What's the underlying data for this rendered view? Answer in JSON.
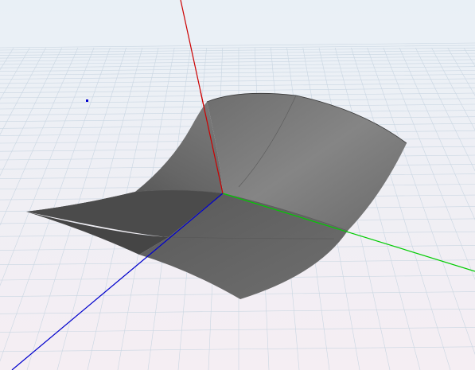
{
  "viewport": {
    "background_top": "#e9f0f6",
    "background_bottom": "#f5eef3",
    "grid_color": "#c9d6e2"
  },
  "axes": {
    "x_axis_color": "#0000cc",
    "y_axis_color": "#00cc00",
    "z_axis_color": "#cc0000"
  },
  "surface": {
    "fill_color": "#7a7a7a",
    "edge_color": "#3a3a3a"
  },
  "marker": {
    "color": "#0000cc"
  }
}
